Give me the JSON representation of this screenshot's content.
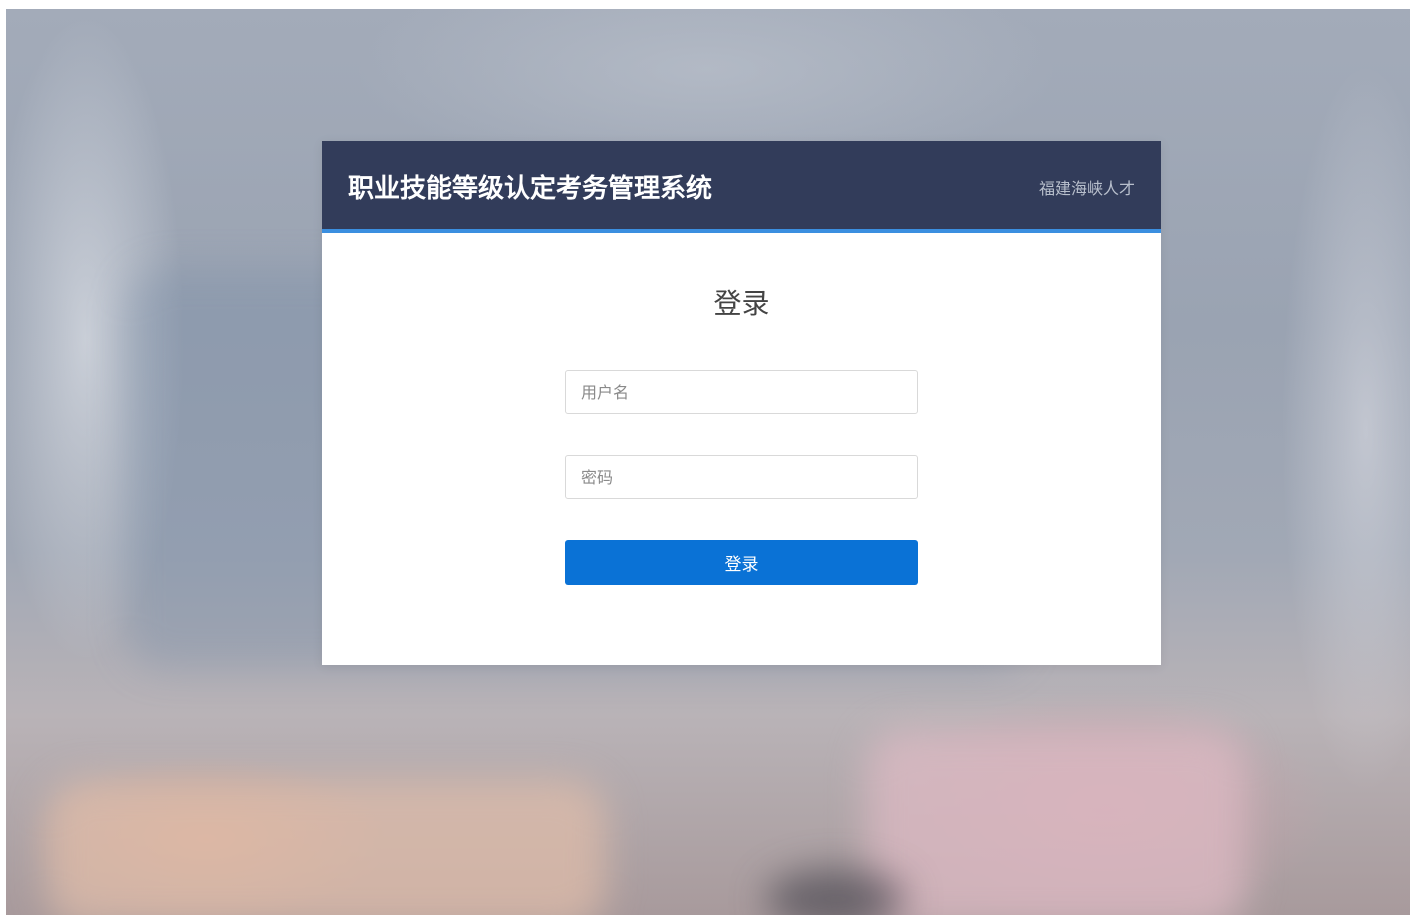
{
  "header": {
    "system_title": "职业技能等级认定考务管理系统",
    "org_name": "福建海峡人才"
  },
  "login_form": {
    "heading": "登录",
    "username_placeholder": "用户名",
    "password_placeholder": "密码",
    "submit_label": "登录"
  },
  "colors": {
    "header_bg": "#323c5a",
    "header_accent": "#3b8fe0",
    "button_bg": "#0a72d6"
  }
}
